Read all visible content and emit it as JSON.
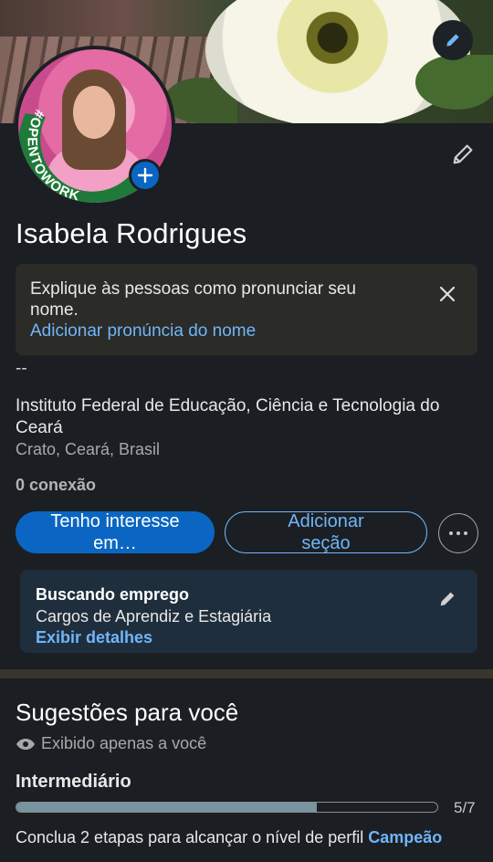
{
  "profile": {
    "name": "Isabela Rodrigues",
    "open_to_work_badge": "#OPENTOWORK",
    "headline": "--",
    "school": "Instituto Federal de Educação, Ciência e Tecnologia do Ceará",
    "location": "Crato, Ceará, Brasil",
    "connections": "0 conexão"
  },
  "pronunciation": {
    "text": "Explique às pessoas como pronunciar seu nome.",
    "link": "Adicionar pronúncia do nome"
  },
  "actions": {
    "primary": "Tenho interesse em…",
    "secondary": "Adicionar seção",
    "more_icon": "ellipsis-icon"
  },
  "open_to_work": {
    "title": "Buscando emprego",
    "roles": "Cargos de Aprendiz e Estagiária",
    "link": "Exibir detalhes"
  },
  "suggestions": {
    "title": "Sugestões para você",
    "visibility": "Exibido apenas a você",
    "level": "Intermediário",
    "progress": {
      "current": 5,
      "total": 7
    },
    "progress_label": "5/7",
    "goal_text": "Conclua 2 etapas para alcançar o nível de perfil",
    "goal_level": "Campeão"
  },
  "colors": {
    "accent": "#0a66c2",
    "link": "#70b5f9",
    "open_to_work_green": "#1f7a3a",
    "background": "#1b1f23"
  }
}
